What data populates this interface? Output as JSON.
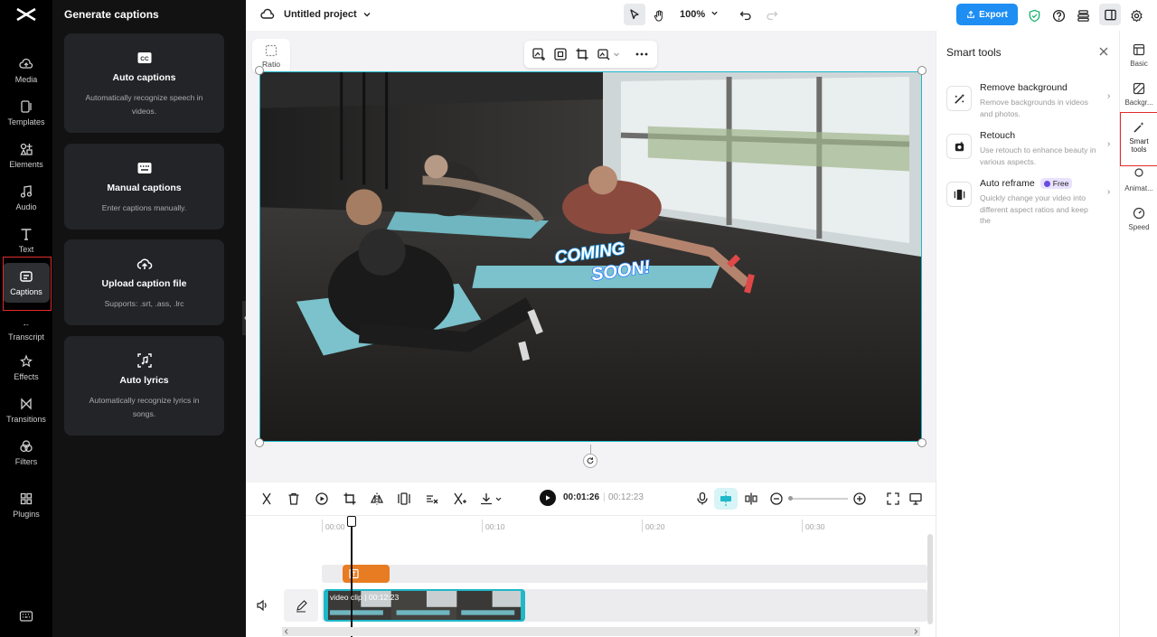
{
  "left_nav": {
    "items": [
      {
        "label": "Media",
        "icon": "cloud-icon"
      },
      {
        "label": "Templates",
        "icon": "templates-icon"
      },
      {
        "label": "Elements",
        "icon": "elements-icon"
      },
      {
        "label": "Audio",
        "icon": "music-icon"
      },
      {
        "label": "Text",
        "icon": "text-icon"
      },
      {
        "label": "Captions",
        "icon": "captions-icon"
      },
      {
        "label": "Transcript",
        "icon": "transcript-icon"
      },
      {
        "label": "Effects",
        "icon": "effects-icon"
      },
      {
        "label": "Transitions",
        "icon": "transitions-icon"
      },
      {
        "label": "Filters",
        "icon": "filters-icon"
      },
      {
        "label": "Plugins",
        "icon": "plugins-icon"
      }
    ]
  },
  "captions_panel": {
    "title": "Generate captions",
    "cards": [
      {
        "title": "Auto captions",
        "desc": "Automatically recognize speech in videos.",
        "icon": "cc-icon"
      },
      {
        "title": "Manual captions",
        "desc": "Enter captions manually.",
        "icon": "keyboard-icon"
      },
      {
        "title": "Upload caption file",
        "desc": "Supports: .srt, .ass, .lrc",
        "icon": "upload-cloud-icon"
      },
      {
        "title": "Auto lyrics",
        "desc": "Automatically recognize lyrics in songs.",
        "icon": "lyrics-icon"
      }
    ]
  },
  "topbar": {
    "project_title": "Untitled project",
    "zoom": "100%",
    "export_label": "Export"
  },
  "canvas": {
    "ratio_label": "Ratio",
    "overlay_text_1": "COMING",
    "overlay_text_2": "SOON!"
  },
  "timeline": {
    "current_time": "00:01:26",
    "total_time": "00:12:23",
    "ruler": [
      "00:00",
      "00:10",
      "00:20",
      "00:30"
    ],
    "clip_label": "video clip | 00:12:23"
  },
  "smart_tools": {
    "title": "Smart tools",
    "tools": [
      {
        "name": "Remove background",
        "desc": "Remove backgrounds in videos and photos.",
        "icon": "remove-bg-icon"
      },
      {
        "name": "Retouch",
        "desc": "Use retouch to enhance beauty in various aspects.",
        "icon": "retouch-icon"
      },
      {
        "name": "Auto reframe",
        "desc": "Quickly change your video into different aspect ratios and keep the",
        "badge": "Free",
        "icon": "reframe-icon"
      }
    ]
  },
  "right_rail": {
    "items": [
      {
        "label": "Basic"
      },
      {
        "label": "Backgr..."
      },
      {
        "label": "Smart tools"
      },
      {
        "label": "Animat..."
      },
      {
        "label": "Speed"
      }
    ]
  },
  "colors": {
    "accent": "#1e8ef3",
    "selection": "#1fb8c9",
    "highlight_box": "#e12b2b",
    "text_clip": "#e87c22"
  }
}
